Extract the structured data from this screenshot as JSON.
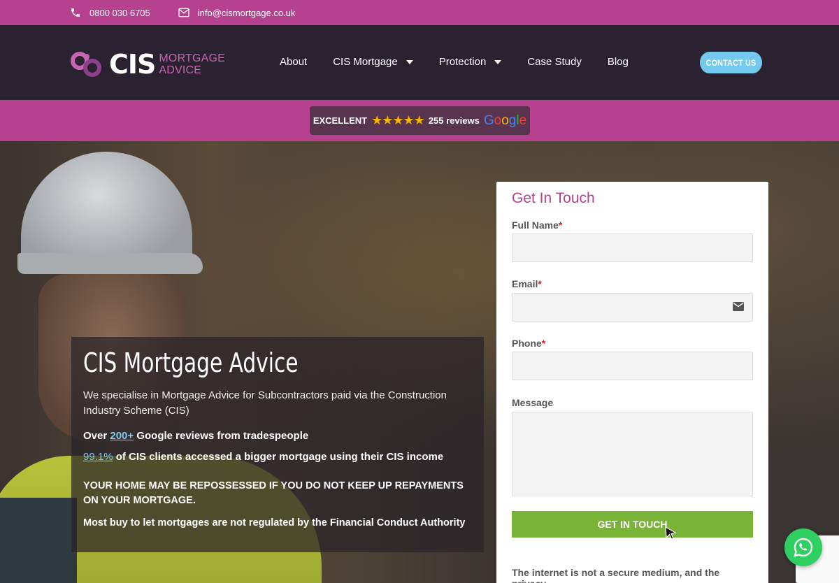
{
  "topbar": {
    "phone": "0800 030 6705",
    "email": "info@cismortgage.co.uk"
  },
  "logo": {
    "cis": "CIS",
    "line1": "MORTGAGE",
    "line2": "ADVICE"
  },
  "nav": {
    "items": [
      {
        "label": "About",
        "dropdown": false
      },
      {
        "label": "CIS Mortgage",
        "dropdown": true
      },
      {
        "label": "Protection",
        "dropdown": true
      },
      {
        "label": "Case Study",
        "dropdown": false
      },
      {
        "label": "Blog",
        "dropdown": false
      }
    ],
    "contact_label": "CONTACT US"
  },
  "reviews": {
    "rating_word": "EXCELLENT",
    "stars": "★★★★★",
    "count": "255 reviews",
    "brand": "Google"
  },
  "hero": {
    "title": "CIS Mortgage Advice",
    "description": "We specialise in Mortgage Advice for Subcontractors paid via the Construction Industry Scheme (CIS)",
    "reviews_line": {
      "prefix": "Over ",
      "link": "200+",
      "suffix": " Google reviews from tradespeople"
    },
    "clients_line": {
      "link": "99.1%",
      "suffix": " of CIS clients accessed a bigger mortgage using their CIS income"
    },
    "warning": "YOUR HOME MAY BE REPOSSESSED IF YOU DO NOT KEEP UP REPAYMENTS ON YOUR MORTGAGE.",
    "regulation": "Most buy to let mortgages are not regulated by the Financial Conduct Authority"
  },
  "form": {
    "title": "Get In Touch",
    "full_name_label": "Full Name",
    "email_label": "Email",
    "phone_label": "Phone",
    "message_label": "Message",
    "required_mark": "*",
    "submit_label": "GET IN TOUCH",
    "privacy_text": "The internet is not a secure medium, and the privacy"
  },
  "colors": {
    "brand_pink": "#b5418f",
    "dark_bg": "#2a2230",
    "contact_button": "#73c9ee",
    "submit_green": "#79b437",
    "link_blue": "#7fc8ef",
    "whatsapp_green": "#2fcf62"
  }
}
